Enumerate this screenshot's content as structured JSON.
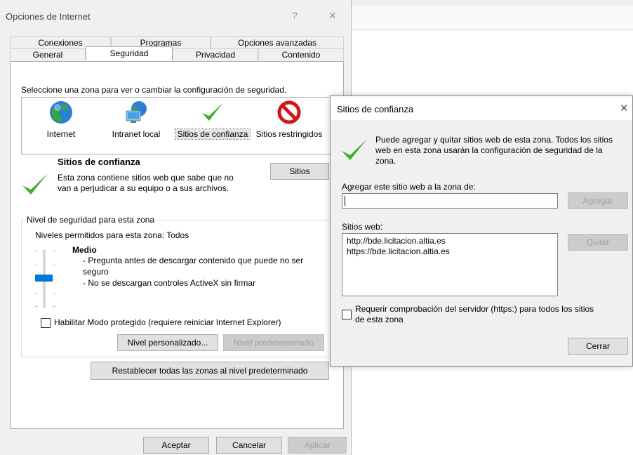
{
  "main": {
    "title": "Opciones de Internet",
    "help_glyph": "?",
    "close_glyph": "✕",
    "tabs_row1": [
      "Conexiones",
      "Programas",
      "Opciones avanzadas"
    ],
    "tabs_row2": [
      "General",
      "Seguridad",
      "Privacidad",
      "Contenido"
    ],
    "zone_prompt": "Seleccione una zona para ver o cambiar la configuración de seguridad.",
    "zones": [
      {
        "label": "Internet",
        "icon": "globe-icon"
      },
      {
        "label": "Intranet local",
        "icon": "intranet-icon"
      },
      {
        "label": "Sitios de confianza",
        "icon": "checkmark-icon"
      },
      {
        "label": "Sitios restringidos",
        "icon": "restricted-icon"
      }
    ],
    "zone_title": "Sitios de confianza",
    "zone_desc_1": "Esta zona contiene sitios web que sabe que no",
    "zone_desc_2": "van a perjudicar a su equipo o a sus archivos.",
    "sites_button": "Sitios",
    "security_level_group": "Nivel de seguridad para esta zona",
    "allowed_levels": "Niveles permitidos para esta zona: Todos",
    "level_name": "Medio",
    "level_line1": "- Pregunta antes de descargar contenido que puede no ser",
    "level_line1b": "seguro",
    "level_line2": "- No se descargan controles ActiveX sin firmar",
    "protected_mode": "Habilitar Modo protegido (requiere reiniciar Internet Explorer)",
    "custom_level_button": "Nivel personalizado...",
    "default_level_button": "Nivel predeterminado",
    "reset_all_button": "Restablecer todas las zonas al nivel predeterminado",
    "ok_button": "Aceptar",
    "cancel_button": "Cancelar",
    "apply_button": "Aplicar"
  },
  "trusted": {
    "title": "Sitios de confianza",
    "close_glyph": "✕",
    "info_1": "Puede agregar y quitar sitios web de esta zona. Todos los sitios",
    "info_2": "web en esta zona usarán la configuración de seguridad de la",
    "info_3": "zona.",
    "add_label": "Agregar este sitio web a la zona de:",
    "add_input_value": "",
    "add_button": "Agregar",
    "websites_label": "Sitios web:",
    "websites": [
      "http://bde.licitacion.altia.es",
      "https://bde.licitacion.altia.es"
    ],
    "remove_button": "Quitar",
    "require_https_1": "Requerir comprobación del servidor (https:) para todos los sitios",
    "require_https_2": "de esta zona",
    "close_button": "Cerrar"
  },
  "colors": {
    "check_green": "#3fae2a",
    "restricted_red": "#d11818",
    "slider_blue": "#0078d7"
  }
}
